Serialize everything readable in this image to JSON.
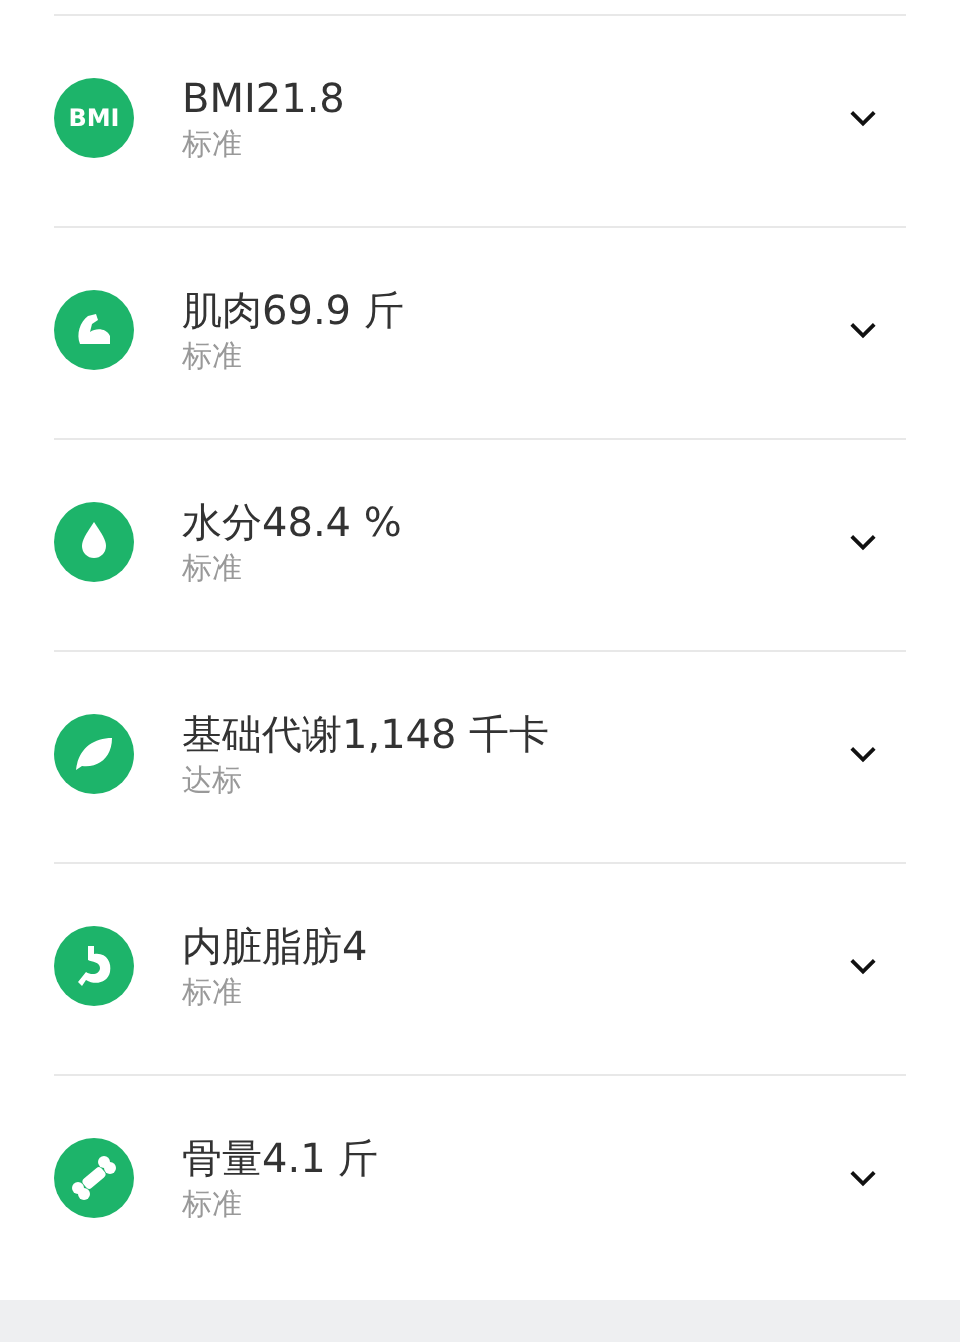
{
  "metrics": [
    {
      "kind": "bmi",
      "badge": "BMI",
      "title": "BMI21.8",
      "status": "标准",
      "expanded": false
    },
    {
      "kind": "muscle",
      "title": "肌肉69.9 斤",
      "status": "标准",
      "expanded": false
    },
    {
      "kind": "drop",
      "title": "水分48.4 %",
      "status": "标准",
      "expanded": false
    },
    {
      "kind": "leaf",
      "title": "基础代谢1,148 千卡",
      "status": "达标",
      "expanded": false
    },
    {
      "kind": "stomach",
      "title": "内脏脂肪4",
      "status": "标准",
      "expanded": false
    },
    {
      "kind": "bone",
      "title": "骨量4.1 斤",
      "status": "标准",
      "expanded": false
    }
  ]
}
